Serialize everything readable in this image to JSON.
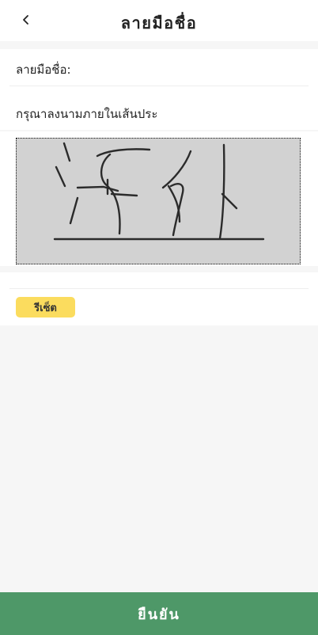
{
  "header": {
    "title": "ลายมือชื่อ",
    "back_icon": "chevron-left-icon"
  },
  "form": {
    "signature_label": "ลายมือชื่อ:",
    "hint": "กรุณาลงนามภายในเส้นประ"
  },
  "signature_pad": {
    "background": "#d2d2d2",
    "stroke_color": "#2b2b2b"
  },
  "actions": {
    "reset_label": "รีเซ็ต",
    "reset_color": "#fbdc5e",
    "confirm_label": "ยืนยัน",
    "confirm_color": "#4e9868"
  }
}
